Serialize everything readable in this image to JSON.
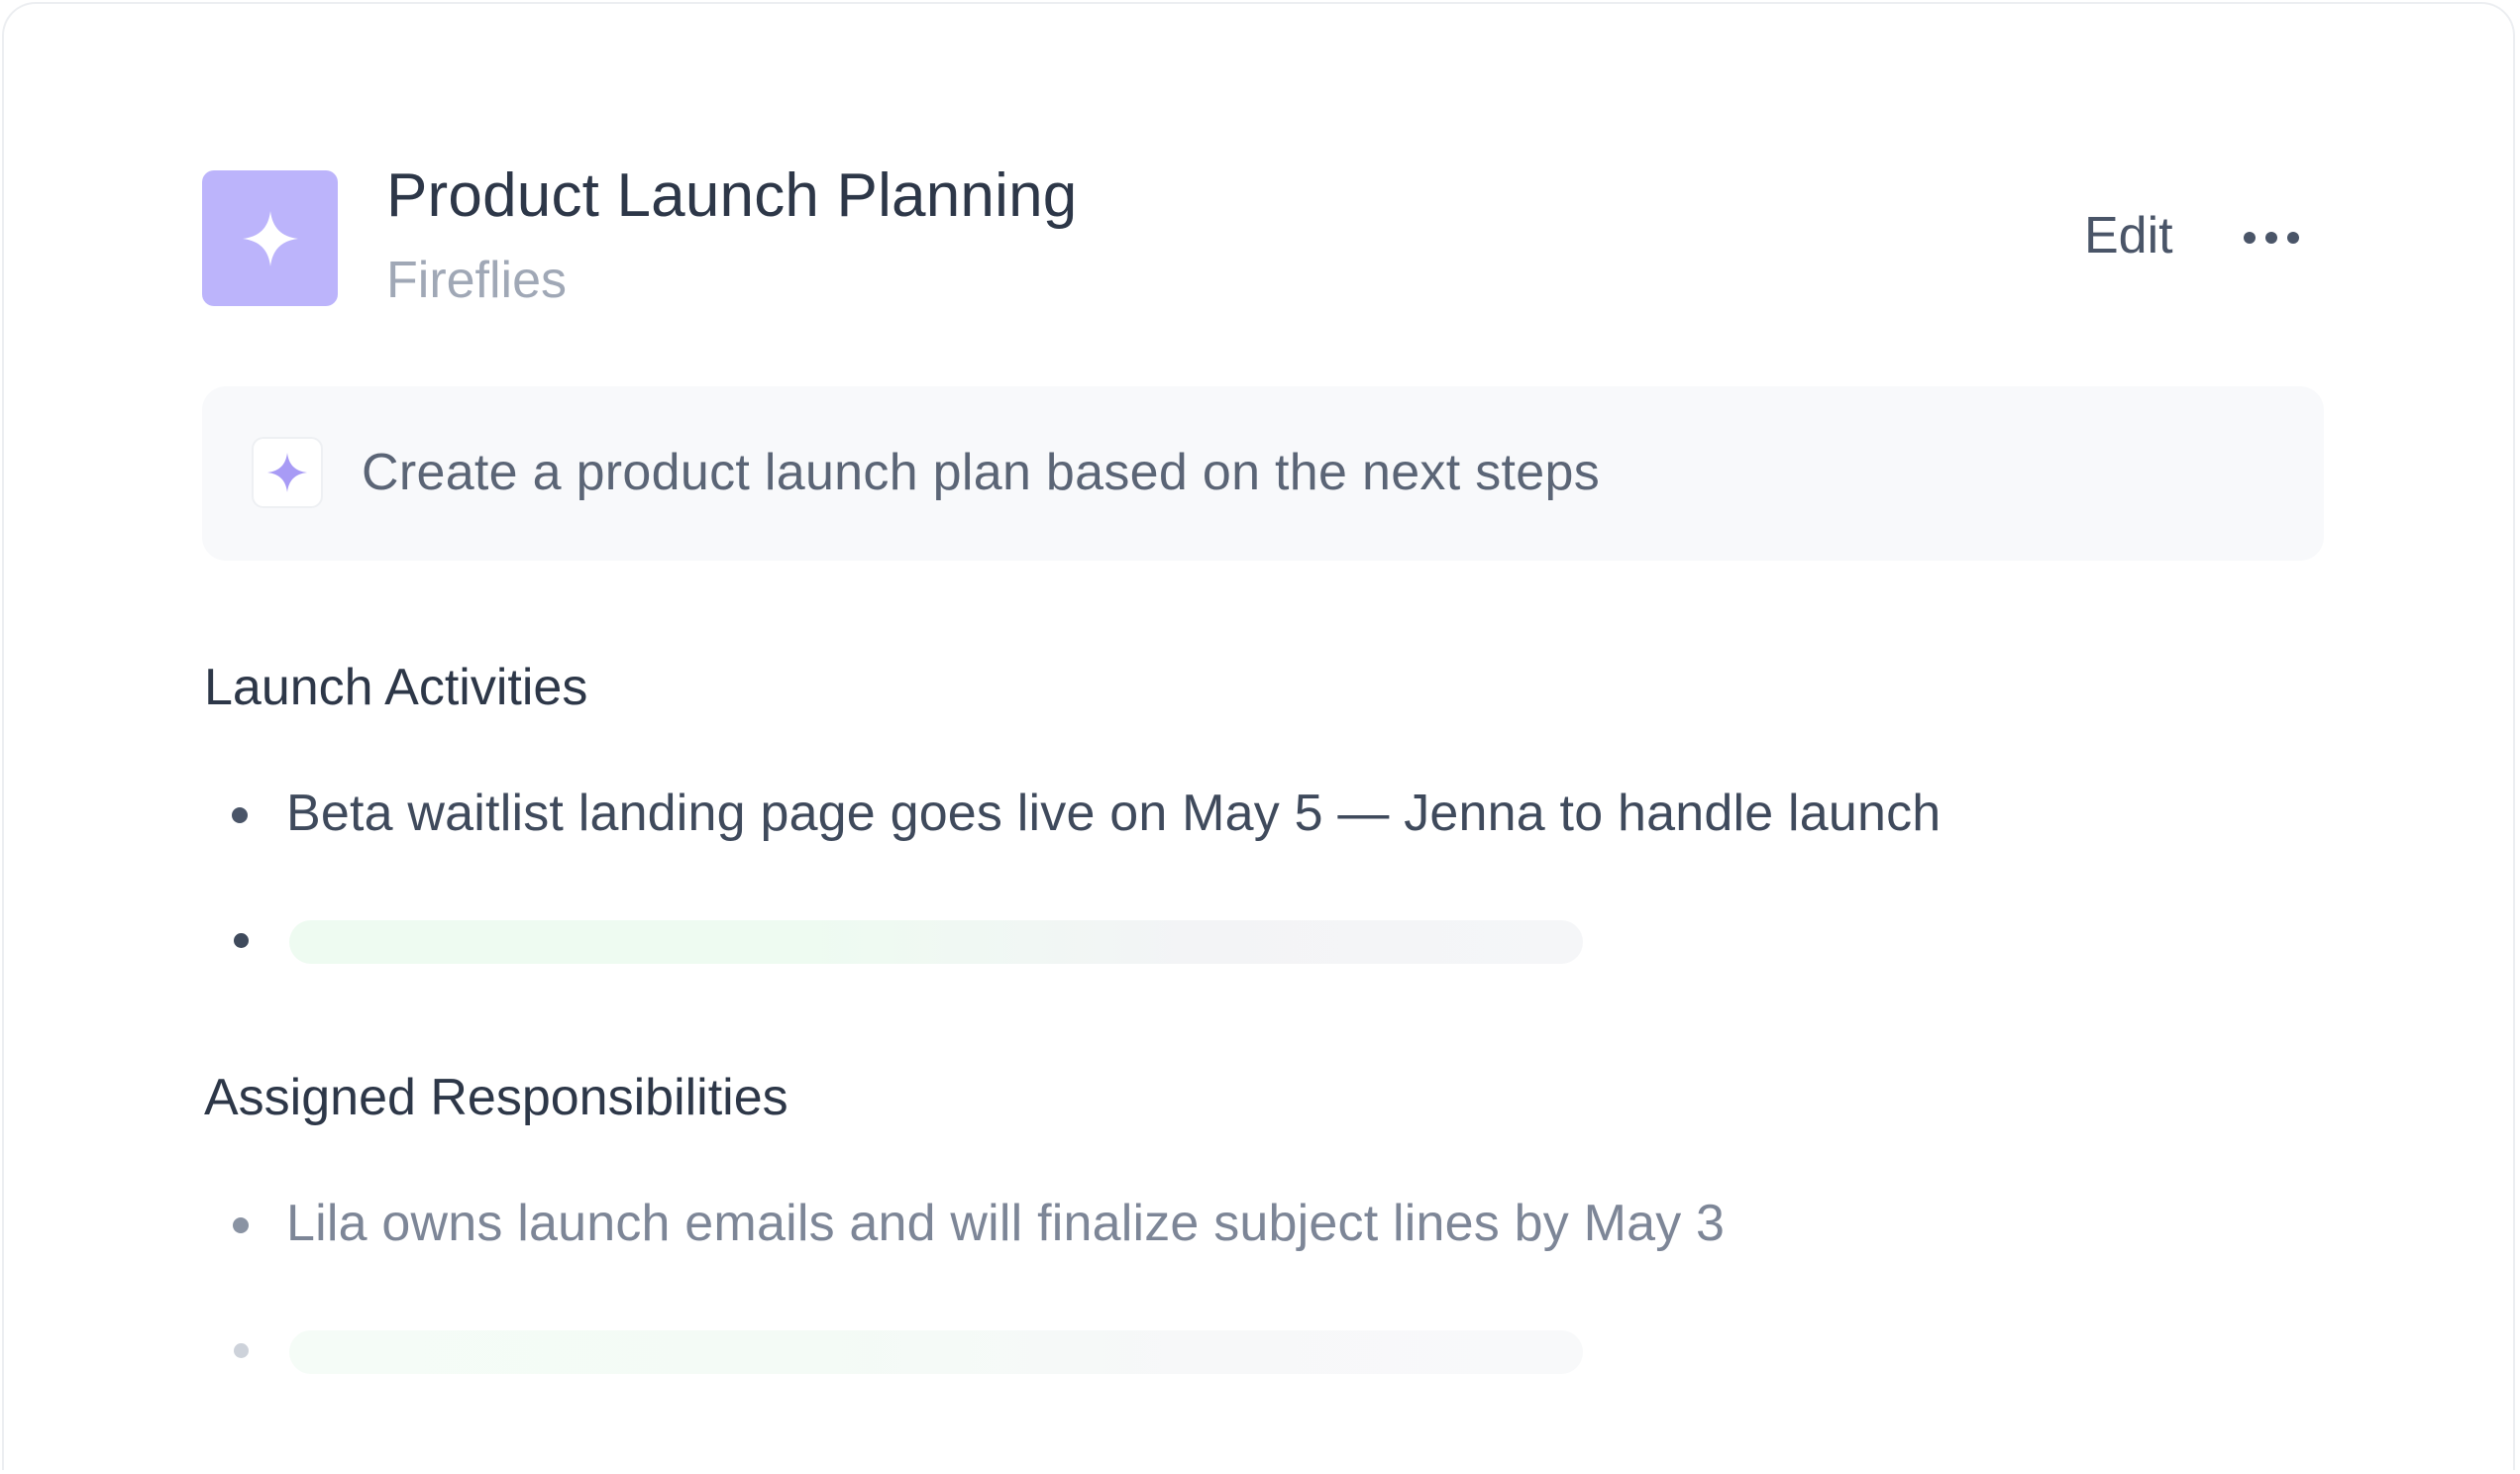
{
  "header": {
    "title": "Product Launch Planning",
    "subtitle": "Fireflies",
    "edit_label": "Edit",
    "app_icon": "sparkle-icon",
    "more_icon": "more-horizontal-icon"
  },
  "prompt": {
    "icon": "sparkle-icon",
    "text": "Create a product launch plan based on the next steps"
  },
  "sections": [
    {
      "title": "Launch Activities",
      "items": [
        "Beta waitlist landing page goes live on May 5 — Jenna to handle launch"
      ]
    },
    {
      "title": "Assigned Responsibilities",
      "items": [
        "Lila owns launch emails and will finalize subject lines by May 3"
      ]
    }
  ],
  "colors": {
    "accent": "#bcb4fb",
    "accent_icon": "#a89bf5",
    "text_primary": "#2d3748",
    "text_muted": "#a0a8b6",
    "loading_green": "#eefbf1"
  }
}
